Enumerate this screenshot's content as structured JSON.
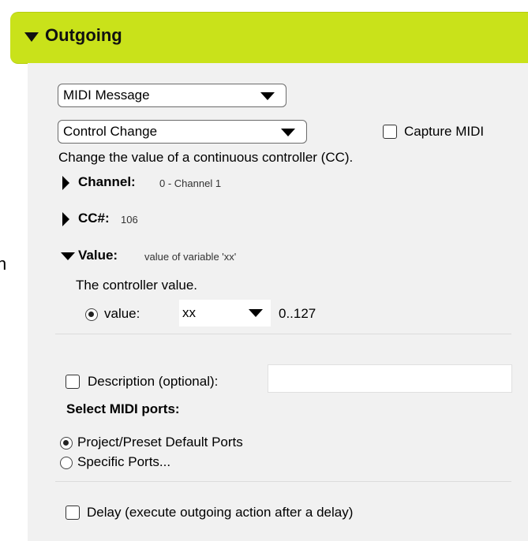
{
  "edge_text": "n",
  "header": {
    "title": "Outgoing"
  },
  "message_type": {
    "selected": "MIDI Message"
  },
  "message_kind": {
    "selected": "Control Change"
  },
  "capture_midi": {
    "label": "Capture MIDI",
    "checked": false
  },
  "description_line": "Change the value of a continuous controller (CC).",
  "channel": {
    "label": "Channel:",
    "value": "0 - Channel 1",
    "expanded": false
  },
  "cc": {
    "label": "CC#:",
    "value": "106",
    "expanded": false
  },
  "value_section": {
    "label": "Value:",
    "summary": "value of variable 'xx'",
    "expanded": true,
    "help": "The controller value.",
    "radio_label": "value:",
    "selected_variable": "xx",
    "range": "0..127"
  },
  "description_opt": {
    "label": "Description (optional):",
    "value": "",
    "checked": false
  },
  "ports": {
    "heading": "Select MIDI ports:",
    "options": [
      {
        "label": "Project/Preset Default Ports",
        "selected": true
      },
      {
        "label": "Specific Ports...",
        "selected": false
      }
    ]
  },
  "delay": {
    "label": "Delay (execute outgoing action after a delay)",
    "checked": false
  },
  "colors": {
    "header_bg": "#c9e21a",
    "panel_bg": "#f1f1f1"
  }
}
